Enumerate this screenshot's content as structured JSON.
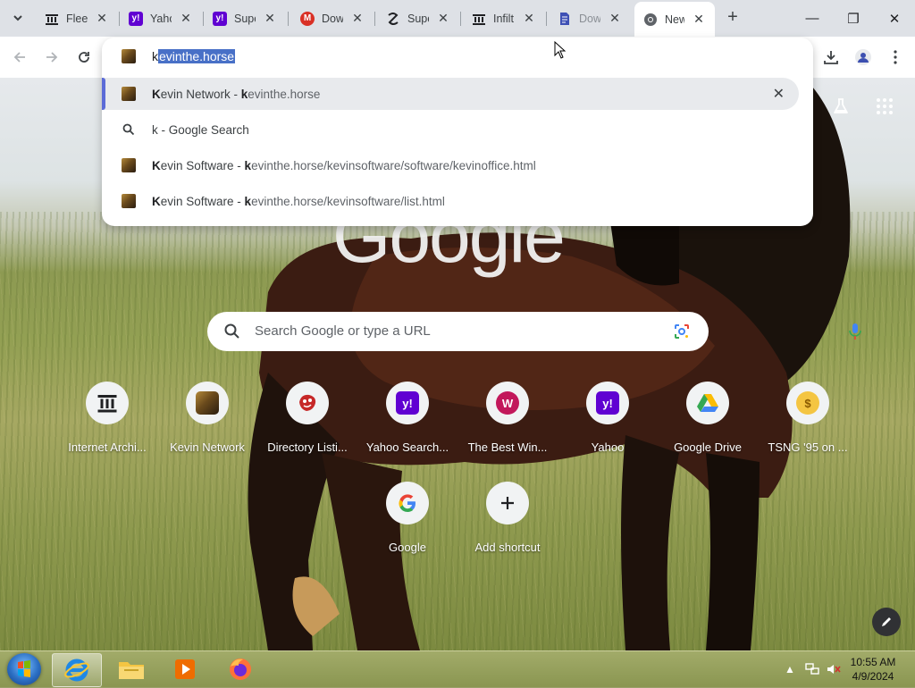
{
  "browser": {
    "tabs": [
      {
        "title": "Fleet",
        "favicon": "internet-archive-icon",
        "close": "✕"
      },
      {
        "title": "Yahoo",
        "favicon": "yahoo-icon",
        "close": "✕"
      },
      {
        "title": "Super",
        "favicon": "yahoo-icon",
        "close": "✕"
      },
      {
        "title": "Down",
        "favicon": "m-icon",
        "close": "✕"
      },
      {
        "title": "Super",
        "favicon": "swirl-icon",
        "close": "✕"
      },
      {
        "title": "Infilt",
        "favicon": "internet-archive-icon",
        "close": "✕"
      },
      {
        "title": "Down",
        "favicon": "blue-doc-icon",
        "close": "✕"
      },
      {
        "title": "New",
        "favicon": "chrome-icon",
        "close": "✕",
        "active": true
      }
    ],
    "new_tab_symbol": "+",
    "window_controls": {
      "minimize": "—",
      "maximize": "❐",
      "close": "✕"
    }
  },
  "omnibox": {
    "typed": "k",
    "autocomplete": "evinthe.horse",
    "suggestions": [
      {
        "bold": "K",
        "rest": "evin Network - ",
        "url_bold": "k",
        "url_rest": "evinthe.horse",
        "type": "history",
        "highlighted": true,
        "remove": "✕"
      },
      {
        "bold": "",
        "rest": "k - Google Search",
        "url_bold": "",
        "url_rest": "",
        "type": "search"
      },
      {
        "bold": "K",
        "rest": "evin Software - ",
        "url_bold": "k",
        "url_rest": "evinthe.horse/kevinsoftware/software/kevinoffice.html",
        "type": "history"
      },
      {
        "bold": "K",
        "rest": "evin Software - ",
        "url_bold": "k",
        "url_rest": "evinthe.horse/kevinsoftware/list.html",
        "type": "history"
      }
    ]
  },
  "ntp": {
    "logo": "Google",
    "search_placeholder": "Search Google or type a URL",
    "shortcuts": [
      {
        "label": "Internet Archi...",
        "icon": "internet-archive-icon"
      },
      {
        "label": "Kevin Network",
        "icon": "horse-icon"
      },
      {
        "label": "Directory Listi...",
        "icon": "red-creature-icon"
      },
      {
        "label": "Yahoo Search...",
        "icon": "yahoo-icon",
        "glyph": "y!"
      },
      {
        "label": "The Best Win...",
        "icon": "w-icon",
        "glyph": "W"
      },
      {
        "label": "Yahoo",
        "icon": "yahoo-icon",
        "glyph": "y!"
      },
      {
        "label": "Google Drive",
        "icon": "google-drive-icon"
      },
      {
        "label": "TSNG '95 on ...",
        "icon": "tsng-icon",
        "glyph": "$"
      },
      {
        "label": "Google",
        "icon": "google-g-icon",
        "glyph": "G"
      },
      {
        "label": "Add shortcut",
        "icon": "plus-icon",
        "glyph": "+"
      }
    ]
  },
  "taskbar": {
    "time": "10:55 AM",
    "date": "4/9/2024"
  },
  "colors": {
    "accent_blue": "#5b6bd7",
    "selection": "#4870c7",
    "yahoo_purple": "#6001d2",
    "tab_strip": "#dee1e6"
  }
}
